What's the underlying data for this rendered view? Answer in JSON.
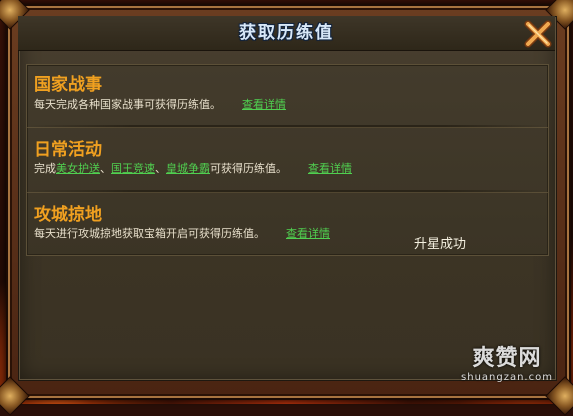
{
  "window": {
    "title": "获取历练值"
  },
  "sections": [
    {
      "title": "国家战事",
      "desc_before": "每天完成各种国家战事可获得历练值。",
      "link": "查看详情"
    },
    {
      "title": "日常活动",
      "desc_prefix": "完成",
      "links_inline": [
        "美女护送",
        "国王竞速",
        "皇城争霸"
      ],
      "sep": "、",
      "desc_suffix": "可获得历练值。",
      "link": "查看详情"
    },
    {
      "title": "攻城掠地",
      "desc_before": "每天进行攻城掠地获取宝箱开启可获得历练值。",
      "link": "查看详情"
    }
  ],
  "toast": "升星成功",
  "watermark": {
    "brand": "爽赞网",
    "url": "shuangzan.com"
  },
  "colors": {
    "section_title": "#f0a020",
    "link": "#50d050",
    "body_text": "#e8e0cc",
    "title_text": "#d8e8f8"
  },
  "icons": {
    "close": "close-x-icon"
  }
}
